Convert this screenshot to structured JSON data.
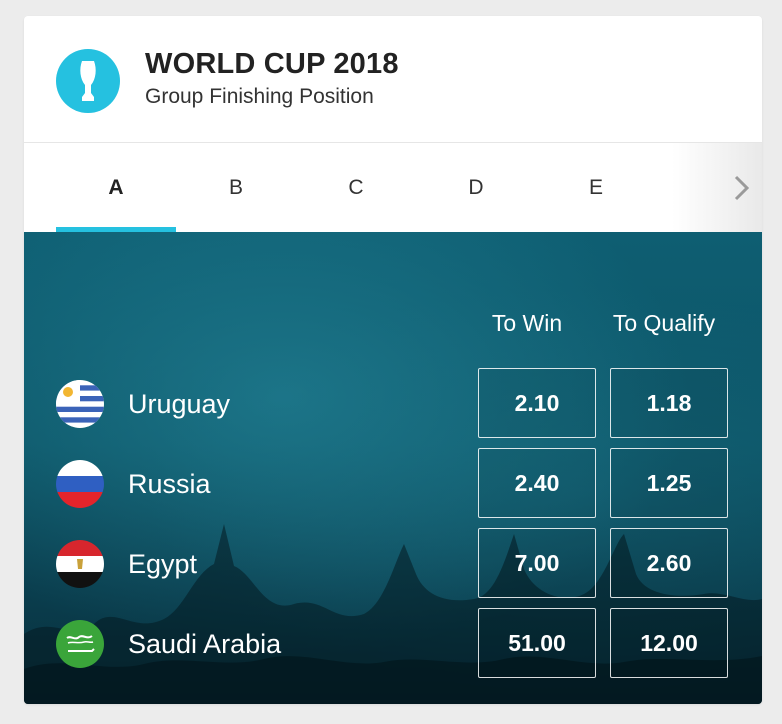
{
  "header": {
    "title": "WORLD CUP 2018",
    "subtitle": "Group Finishing Position",
    "logo_icon": "trophy-icon"
  },
  "tabs": {
    "items": [
      "A",
      "B",
      "C",
      "D",
      "E"
    ],
    "active": "A",
    "next_icon": "chevron-right-icon"
  },
  "market": {
    "columns": [
      "To Win",
      "To Qualify"
    ],
    "rows": [
      {
        "team": "Uruguay",
        "flag": "uruguay-flag",
        "to_win": "2.10",
        "to_qualify": "1.18"
      },
      {
        "team": "Russia",
        "flag": "russia-flag",
        "to_win": "2.40",
        "to_qualify": "1.25"
      },
      {
        "team": "Egypt",
        "flag": "egypt-flag",
        "to_win": "7.00",
        "to_qualify": "2.60"
      },
      {
        "team": "Saudi Arabia",
        "flag": "saudi-arabia-flag",
        "to_win": "51.00",
        "to_qualify": "12.00"
      }
    ]
  },
  "colors": {
    "accent": "#25c1e0",
    "panel": "#0c5466"
  }
}
